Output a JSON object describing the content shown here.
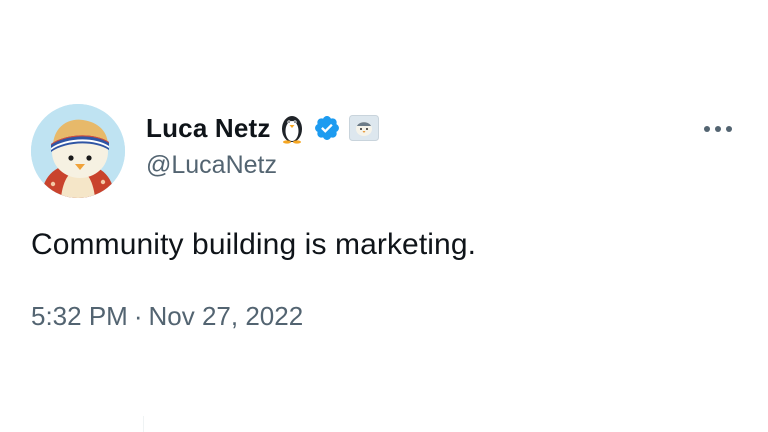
{
  "author": {
    "display_name": "Luca Netz",
    "handle": "@LucaNetz",
    "icons": [
      "penguin-emoji",
      "verified-badge-icon",
      "affiliate-badge-icon"
    ]
  },
  "tweet": {
    "text": "Community building is marketing.",
    "time": "5:32 PM",
    "separator": "·",
    "date": "Nov 27, 2022"
  },
  "actions": {
    "more_icon": "more-horizontal-icon"
  },
  "colors": {
    "text_primary": "#0f1419",
    "text_secondary": "#536471",
    "verified_blue": "#1d9bf0",
    "background": "#ffffff"
  }
}
